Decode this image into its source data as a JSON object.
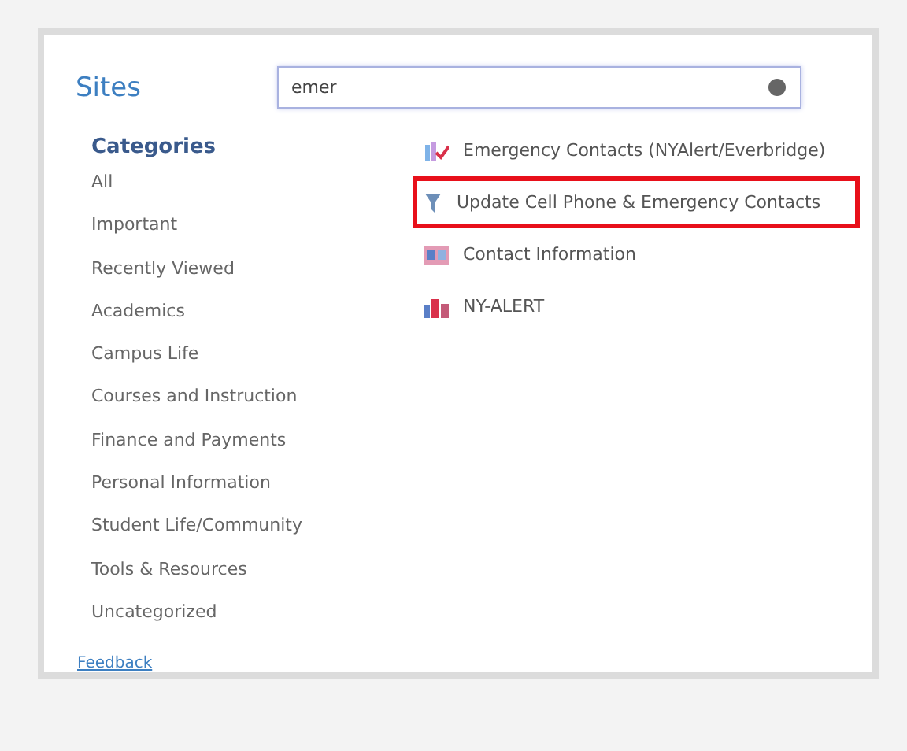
{
  "header": {
    "title": "Sites"
  },
  "search": {
    "value": "emer"
  },
  "categories": {
    "title": "Categories",
    "items": [
      {
        "label": "All"
      },
      {
        "label": "Important"
      },
      {
        "label": "Recently Viewed"
      },
      {
        "label": "Academics"
      },
      {
        "label": "Campus Life"
      },
      {
        "label": "Courses and Instruction"
      },
      {
        "label": "Finance and Payments"
      },
      {
        "label": "Personal Information"
      },
      {
        "label": "Student Life/Community"
      },
      {
        "label": "Tools & Resources"
      },
      {
        "label": "Uncategorized"
      }
    ]
  },
  "results": [
    {
      "label": "Emergency Contacts (NYAlert/Everbridge)",
      "kind": "checklist",
      "highlighted": false
    },
    {
      "label": "Update Cell Phone & Emergency Contacts",
      "kind": "funnel",
      "highlighted": true
    },
    {
      "label": "Contact Information",
      "kind": "card",
      "highlighted": false
    },
    {
      "label": "NY-ALERT",
      "kind": "building",
      "highlighted": false
    }
  ],
  "footer": {
    "link": "Feedback"
  }
}
